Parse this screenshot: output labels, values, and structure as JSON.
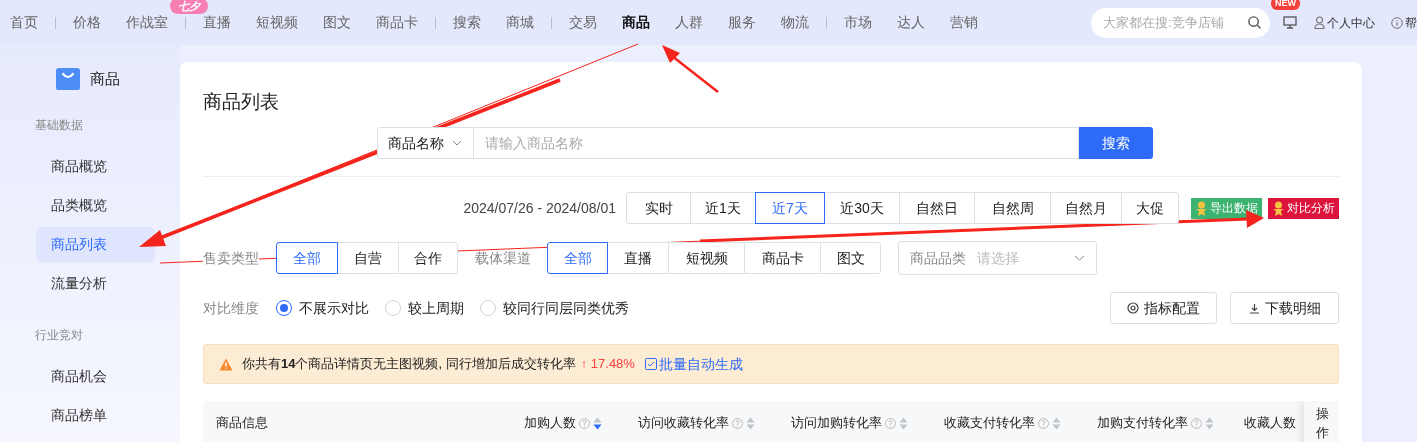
{
  "top_nav": {
    "groups": [
      {
        "items": [
          {
            "label": "首页",
            "selected": false
          }
        ]
      },
      {
        "items": [
          {
            "label": "价格",
            "selected": false
          },
          {
            "label": "作战室",
            "selected": false,
            "badge": "七夕"
          }
        ]
      },
      {
        "items": [
          {
            "label": "直播",
            "selected": false
          },
          {
            "label": "短视频",
            "selected": false
          },
          {
            "label": "图文",
            "selected": false
          },
          {
            "label": "商品卡",
            "selected": false
          }
        ]
      },
      {
        "items": [
          {
            "label": "搜索",
            "selected": false
          },
          {
            "label": "商城",
            "selected": false
          }
        ]
      },
      {
        "items": [
          {
            "label": "交易",
            "selected": false
          },
          {
            "label": "商品",
            "selected": true
          },
          {
            "label": "人群",
            "selected": false
          },
          {
            "label": "服务",
            "selected": false
          },
          {
            "label": "物流",
            "selected": false
          }
        ]
      },
      {
        "items": [
          {
            "label": "市场",
            "selected": false
          },
          {
            "label": "达人",
            "selected": false
          },
          {
            "label": "营销",
            "selected": false
          }
        ]
      }
    ],
    "search": {
      "placeholder": "大家都在搜:竞争店铺"
    },
    "new_badge": "NEW",
    "user_link": "个人中心",
    "help_link": "帮"
  },
  "sidebar": {
    "title": "商品",
    "sections": [
      {
        "heading": "基础数据",
        "items": [
          {
            "label": "商品概览",
            "selected": false
          },
          {
            "label": "品类概览",
            "selected": false
          },
          {
            "label": "商品列表",
            "selected": true
          },
          {
            "label": "流量分析",
            "selected": false
          }
        ]
      },
      {
        "heading": "行业竞对",
        "items": [
          {
            "label": "商品机会",
            "selected": false
          },
          {
            "label": "商品榜单",
            "selected": false
          }
        ]
      }
    ]
  },
  "main": {
    "title": "商品列表",
    "search": {
      "field_select": "商品名称",
      "placeholder": "请输入商品名称",
      "button": "搜索"
    },
    "date_range": "2024/07/26 - 2024/08/01",
    "date_tabs": [
      {
        "label": "实时",
        "selected": false
      },
      {
        "label": "近1天",
        "selected": false
      },
      {
        "label": "近7天",
        "selected": true
      },
      {
        "label": "近30天",
        "selected": false
      },
      {
        "label": "自然日",
        "selected": false
      },
      {
        "label": "自然周",
        "selected": false
      },
      {
        "label": "自然月",
        "selected": false
      },
      {
        "label": "大促",
        "selected": false
      }
    ],
    "plugin_buttons": [
      {
        "label": "导出数据",
        "color": "#3cb371"
      },
      {
        "label": "对比分析",
        "color": "#dc143c"
      }
    ],
    "sale_type": {
      "label": "售卖类型",
      "options": [
        {
          "label": "全部",
          "selected": true
        },
        {
          "label": "自营",
          "selected": false
        },
        {
          "label": "合作",
          "selected": false
        }
      ]
    },
    "channel": {
      "label": "载体渠道",
      "options": [
        {
          "label": "全部",
          "selected": true
        },
        {
          "label": "直播",
          "selected": false
        },
        {
          "label": "短视频",
          "selected": false
        },
        {
          "label": "商品卡",
          "selected": false
        },
        {
          "label": "图文",
          "selected": false
        }
      ]
    },
    "category": {
      "label": "商品品类",
      "placeholder": "请选择"
    },
    "compare": {
      "label": "对比维度",
      "options": [
        {
          "label": "不展示对比",
          "selected": true
        },
        {
          "label": "较上周期",
          "selected": false
        },
        {
          "label": "较同行同层同类优秀",
          "selected": false
        }
      ]
    },
    "actions": [
      "指标配置",
      "下载明细"
    ],
    "alert": {
      "text": "你共有**14**个商品详情页无主图视频, 同行增加后成交转化率",
      "rate": "↑ 17.48%",
      "link": "批量自动生成"
    },
    "table": {
      "columns": [
        {
          "label": "商品信息",
          "kind": "plain"
        },
        {
          "label": "加购人数",
          "kind": "metric",
          "sorted_desc": true
        },
        {
          "label": "访问收藏转化率",
          "kind": "metric",
          "sorted_desc": false
        },
        {
          "label": "访问加购转化率",
          "kind": "metric",
          "sorted_desc": false
        },
        {
          "label": "收藏支付转化率",
          "kind": "metric",
          "sorted_desc": false
        },
        {
          "label": "加购支付转化率",
          "kind": "metric",
          "sorted_desc": false
        },
        {
          "label": "收藏人数",
          "kind": "cut"
        },
        {
          "label": "操作",
          "kind": "fixed"
        }
      ]
    }
  }
}
